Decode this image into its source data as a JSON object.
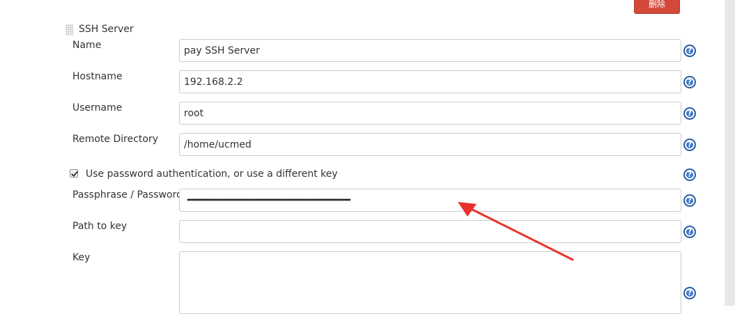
{
  "header": {
    "delete_label": "删除"
  },
  "section": {
    "title": "SSH Server"
  },
  "fields": {
    "name": {
      "label": "Name",
      "value": "pay SSH Server"
    },
    "hostname": {
      "label": "Hostname",
      "value": "192.168.2.2"
    },
    "username": {
      "label": "Username",
      "value": "root"
    },
    "remote_directory": {
      "label": "Remote Directory",
      "value": "/home/ucmed"
    },
    "use_password": {
      "label": "Use password authentication, or use a different key",
      "checked": true
    },
    "passphrase": {
      "label": "Passphrase / Password",
      "masked_value": "••••••••••••••••••••••••••••••••••••••••••••••••••••••••••••••••••••••••••••••••••••"
    },
    "path_to_key": {
      "label": "Path to key",
      "value": ""
    },
    "key": {
      "label": "Key",
      "value": ""
    }
  },
  "help": {
    "glyph": "?"
  },
  "icons": {
    "help": "help-question-icon",
    "drag": "drag-handle-icon",
    "check": "checkmark-icon",
    "annotation": "red-arrow-annotation"
  },
  "colors": {
    "delete_button": "#d24939",
    "help_icon": "#3c78c6",
    "annotation_arrow": "#e8312b"
  }
}
